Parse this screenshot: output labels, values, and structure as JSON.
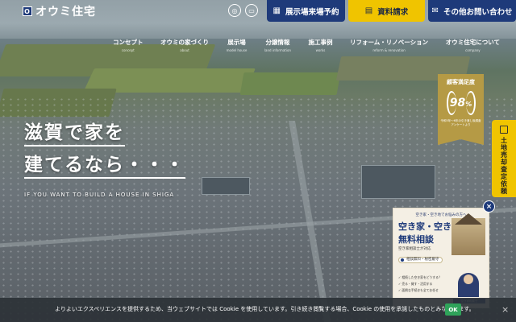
{
  "header": {
    "logo_text": "オウミ住宅",
    "logo_mark": "O",
    "buttons": [
      {
        "label": "展示場来場予約",
        "icon": "calendar-icon",
        "bg": "#1e3a7a",
        "fg": "#ffffff"
      },
      {
        "label": "資料請求",
        "icon": "document-icon",
        "bg": "#f0c400",
        "fg": "#1e2a44"
      },
      {
        "label": "その他お問い合わせ",
        "icon": "mail-icon",
        "bg": "#1e3a7a",
        "fg": "#ffffff"
      }
    ]
  },
  "nav": [
    {
      "label": "コンセプト",
      "sub": "concept"
    },
    {
      "label": "オウミの家づくり",
      "sub": "about"
    },
    {
      "label": "展示場",
      "sub": "model house"
    },
    {
      "label": "分譲情報",
      "sub": "land information"
    },
    {
      "label": "施工事例",
      "sub": "works"
    },
    {
      "label": "リフォーム・リノベーション",
      "sub": "reform & renovation"
    },
    {
      "label": "オウミ住宅について",
      "sub": "company"
    }
  ],
  "hero": {
    "headline_1": "滋賀で家を",
    "headline_2": "建てるなら・・・",
    "tagline": "IF YOU WANT TO BUILD A HOUSE IN SHIGA"
  },
  "badge": {
    "title": "顧客満足度",
    "value": "98",
    "unit": "%",
    "note": "令和5年〜6年の引き渡し後調査アンケートより"
  },
  "sidetab": {
    "label": "土地売却査定依頼"
  },
  "popup": {
    "header": "空き家・空き地でお悩みの方へ",
    "title_1": "空き家・空き地",
    "title_2": "無料相談",
    "sub": "空き家相談士が対応",
    "chips": [
      "相談無料・秘密厳守"
    ],
    "list": [
      "✓ 相続した空き家をどうする？",
      "✓ 売る・貸す・活用する",
      "✓ 面倒な手続きも全てお任せ"
    ],
    "caption": "空き家相談士"
  },
  "cookie": {
    "message": "よりよいエクスペリエンスを提供するため、当ウェブサイトでは Cookie を使用しています。引き続き閲覧する場合、Cookie の使用を承諾したものとみなされます。",
    "ok_label": "OK",
    "close_label": "×"
  }
}
